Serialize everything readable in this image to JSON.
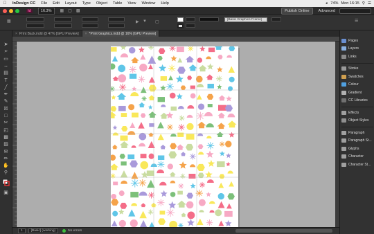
{
  "menubar": {
    "apple_icon": "apple-logo-icon",
    "items": [
      "InDesign CC",
      "File",
      "Edit",
      "Layout",
      "Type",
      "Object",
      "Table",
      "View",
      "Window",
      "Help"
    ],
    "battery": "74%",
    "clock": "Mon 16:15"
  },
  "appbar": {
    "logo": "Id",
    "zoom": "16.3%",
    "publish_label": "Publish Online",
    "workspace_label": "Advanced"
  },
  "controlbar": {
    "paragraph_style": "[Basic Graphics Frame]"
  },
  "tabs": [
    {
      "label": "Print Back.indd @ 47% [GPU Preview]",
      "active": false
    },
    {
      "label": "*Print Graphics.indd @ 16% [GPU Preview]",
      "active": true
    }
  ],
  "statusbar": {
    "page": "1",
    "preflight_profile": "[Basic] (working)",
    "errors": "No errors"
  },
  "panels": [
    {
      "label": "Pages",
      "icon": "pages-icon",
      "color": "#6a8fd0"
    },
    {
      "label": "Layers",
      "icon": "layers-icon",
      "color": "#8ab0e0"
    },
    {
      "label": "Links",
      "icon": "links-icon",
      "color": "#8a8a8a"
    },
    {
      "label": "Stroke",
      "icon": "stroke-icon",
      "color": "#9a9a9a"
    },
    {
      "label": "Swatches",
      "icon": "swatches-icon",
      "color": "#d0a050"
    },
    {
      "label": "Colour",
      "icon": "colour-icon",
      "color": "#50a0e0"
    },
    {
      "label": "Gradient",
      "icon": "gradient-icon",
      "color": "#b0b0b0"
    },
    {
      "label": "CC Libraries",
      "icon": "cc-libraries-icon",
      "color": "#707070"
    },
    {
      "label": "Effects",
      "icon": "effects-icon",
      "color": "#a0a0a0"
    },
    {
      "label": "Object Styles",
      "icon": "object-styles-icon",
      "color": "#909090"
    },
    {
      "label": "Paragraph",
      "icon": "paragraph-icon",
      "color": "#a0a0a0"
    },
    {
      "label": "Paragraph St...",
      "icon": "paragraph-styles-icon",
      "color": "#a0a0a0"
    },
    {
      "label": "Glyphs",
      "icon": "glyphs-icon",
      "color": "#a0a0a0"
    },
    {
      "label": "Character",
      "icon": "character-icon",
      "color": "#a0a0a0"
    },
    {
      "label": "Character St...",
      "icon": "character-styles-icon",
      "color": "#a0a0a0"
    }
  ],
  "pattern_colors": [
    "#f9e85a",
    "#f46d88",
    "#f7a9c4",
    "#5fc6e8",
    "#7cc07a",
    "#a99adb",
    "#f5a34a",
    "#c9dca0"
  ]
}
